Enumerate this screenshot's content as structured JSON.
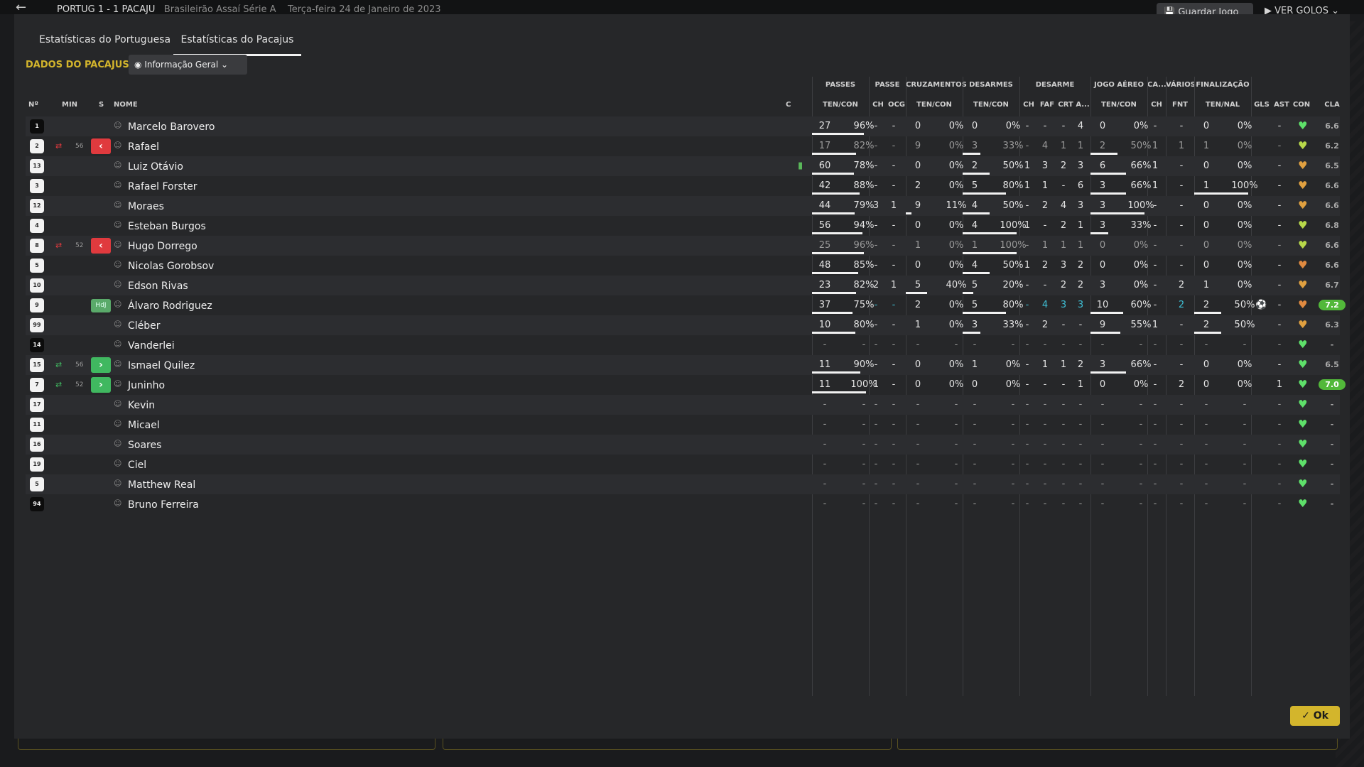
{
  "app": {
    "back_icon": "arrow-left-icon",
    "match_title": "PORTUG 1 - 1 PACAJU",
    "competition": "Brasileirão Assaí Série A",
    "date": "Terça-feira 24 de Janeiro de 2023",
    "save_label": "Guardar Jogo",
    "goals_label": "VER GOLOS"
  },
  "tabs": [
    {
      "label": "Estatísticas do Portuguesa"
    },
    {
      "label": "Estatísticas do Pacajus"
    }
  ],
  "section_label": "DADOS DO PACAJUS",
  "view_dropdown": {
    "value": "Informação Geral",
    "icon": "eye-icon"
  },
  "groups": {
    "passes": "PASSES",
    "passe": "PASSE",
    "cruz": "CRUZAMENTOS",
    "desarmes": "DESARMES",
    "desarme": "DESARME",
    "jogo": "JOGO AÉREO",
    "ca": "CA...",
    "varios": "VÁRIOS",
    "final": "FINALIZAÇÃO"
  },
  "columns": {
    "no": "Nº",
    "min": "MIN",
    "s": "S",
    "nome": "NOME",
    "c": "C",
    "passes": "TEN/CON",
    "passe_ch": "CH",
    "passe_ocg": "OCG",
    "cruz": "TEN/CON",
    "desarmes": "TEN/CON",
    "des_ch": "CH",
    "des_faf": "FAF",
    "des_crt": "CRT",
    "des_a": "A...",
    "jogo": "TEN/CON",
    "ca_ch": "CH",
    "fnt": "FNT",
    "final": "TEN/NAL",
    "gls": "GLS",
    "ast": "AST",
    "con": "CON",
    "cla": "CLA"
  },
  "colors": {
    "accent": "#d3b52c",
    "sub_off": "#e03a3e",
    "sub_on": "#40b860",
    "rating_highlight": "#52b83a",
    "player_of_match": "#3fc0d6"
  },
  "players": [
    {
      "num": "1",
      "dark": true,
      "name": "Marcelo Barovero",
      "min": "",
      "s": "",
      "sub": "",
      "pt": "27",
      "pp": "96%",
      "pr": 0.96,
      "pch": "-",
      "ocg": "-",
      "ct": "0",
      "cp": "0%",
      "cr": 0,
      "dt": "0",
      "dp": "0%",
      "dr": 0,
      "dch": "-",
      "faf": "-",
      "crt": "-",
      "a": "4",
      "jt": "0",
      "jp": "0%",
      "jr": 0,
      "cach": "-",
      "fnt": "-",
      "ft": "0",
      "fp": "0%",
      "fr": 0,
      "gls": "",
      "ast": "-",
      "con": "#5ee06a",
      "cla": "6.6",
      "hl": false,
      "muted": false,
      "blue": false,
      "hdj": false,
      "c_icon": ""
    },
    {
      "num": "2",
      "dark": false,
      "name": "Rafael",
      "min": "56",
      "s": "off",
      "sub": "red",
      "pt": "17",
      "pp": "82%",
      "pr": 0.82,
      "pch": "-",
      "ocg": "-",
      "ct": "9",
      "cp": "0%",
      "cr": 0,
      "dt": "3",
      "dp": "33%",
      "dr": 0.33,
      "dch": "-",
      "faf": "4",
      "crt": "1",
      "a": "1",
      "jt": "2",
      "jp": "50%",
      "jr": 0.5,
      "cach": "1",
      "fnt": "1",
      "ft": "1",
      "fp": "0%",
      "fr": 0,
      "gls": "",
      "ast": "-",
      "con": "#b8d84a",
      "cla": "6.2",
      "hl": false,
      "muted": true,
      "blue": false,
      "hdj": false,
      "c_icon": ""
    },
    {
      "num": "13",
      "dark": false,
      "name": "Luiz Otávio",
      "min": "",
      "s": "",
      "sub": "",
      "pt": "60",
      "pp": "78%",
      "pr": 0.78,
      "pch": "-",
      "ocg": "-",
      "ct": "0",
      "cp": "0%",
      "cr": 0,
      "dt": "2",
      "dp": "50%",
      "dr": 0.5,
      "dch": "1",
      "faf": "3",
      "crt": "2",
      "a": "3",
      "jt": "6",
      "jp": "66%",
      "jr": 0.66,
      "cach": "1",
      "fnt": "-",
      "ft": "0",
      "fp": "0%",
      "fr": 0,
      "gls": "",
      "ast": "-",
      "con": "#e0a040",
      "cla": "6.5",
      "hl": false,
      "muted": false,
      "blue": false,
      "hdj": false,
      "c_icon": "card"
    },
    {
      "num": "3",
      "dark": false,
      "name": "Rafael Forster",
      "min": "",
      "s": "",
      "sub": "",
      "pt": "42",
      "pp": "88%",
      "pr": 0.88,
      "pch": "-",
      "ocg": "-",
      "ct": "2",
      "cp": "0%",
      "cr": 0,
      "dt": "5",
      "dp": "80%",
      "dr": 0.8,
      "dch": "1",
      "faf": "1",
      "crt": "-",
      "a": "6",
      "jt": "3",
      "jp": "66%",
      "jr": 0.66,
      "cach": "1",
      "fnt": "-",
      "ft": "1",
      "fp": "100%",
      "fr": 1,
      "gls": "",
      "ast": "-",
      "con": "#e0a040",
      "cla": "6.6",
      "hl": false,
      "muted": false,
      "blue": false,
      "hdj": false,
      "c_icon": ""
    },
    {
      "num": "12",
      "dark": false,
      "name": "Moraes",
      "min": "",
      "s": "",
      "sub": "",
      "pt": "44",
      "pp": "79%",
      "pr": 0.79,
      "pch": "3",
      "ocg": "1",
      "ct": "9",
      "cp": "11%",
      "cr": 0.11,
      "dt": "4",
      "dp": "50%",
      "dr": 0.5,
      "dch": "-",
      "faf": "2",
      "crt": "4",
      "a": "3",
      "jt": "3",
      "jp": "100%",
      "jr": 1,
      "cach": "-",
      "fnt": "-",
      "ft": "0",
      "fp": "0%",
      "fr": 0,
      "gls": "",
      "ast": "-",
      "con": "#e0a040",
      "cla": "6.6",
      "hl": false,
      "muted": false,
      "blue": false,
      "hdj": false,
      "c_icon": ""
    },
    {
      "num": "4",
      "dark": false,
      "name": "Esteban Burgos",
      "min": "",
      "s": "",
      "sub": "",
      "pt": "56",
      "pp": "94%",
      "pr": 0.94,
      "pch": "-",
      "ocg": "-",
      "ct": "0",
      "cp": "0%",
      "cr": 0,
      "dt": "4",
      "dp": "100%",
      "dr": 1,
      "dch": "1",
      "faf": "-",
      "crt": "2",
      "a": "1",
      "jt": "3",
      "jp": "33%",
      "jr": 0.33,
      "cach": "-",
      "fnt": "-",
      "ft": "0",
      "fp": "0%",
      "fr": 0,
      "gls": "",
      "ast": "-",
      "con": "#b8d84a",
      "cla": "6.8",
      "hl": false,
      "muted": false,
      "blue": false,
      "hdj": false,
      "c_icon": ""
    },
    {
      "num": "8",
      "dark": false,
      "name": "Hugo Dorrego",
      "min": "52",
      "s": "off",
      "sub": "red",
      "pt": "25",
      "pp": "96%",
      "pr": 0.96,
      "pch": "-",
      "ocg": "-",
      "ct": "1",
      "cp": "0%",
      "cr": 0,
      "dt": "1",
      "dp": "100%",
      "dr": 1,
      "dch": "-",
      "faf": "1",
      "crt": "1",
      "a": "1",
      "jt": "0",
      "jp": "0%",
      "jr": 0,
      "cach": "-",
      "fnt": "-",
      "ft": "0",
      "fp": "0%",
      "fr": 0,
      "gls": "",
      "ast": "-",
      "con": "#b8d84a",
      "cla": "6.6",
      "hl": false,
      "muted": true,
      "blue": false,
      "hdj": false,
      "c_icon": ""
    },
    {
      "num": "5",
      "dark": false,
      "name": "Nicolas Gorobsov",
      "min": "",
      "s": "",
      "sub": "",
      "pt": "48",
      "pp": "85%",
      "pr": 0.85,
      "pch": "-",
      "ocg": "-",
      "ct": "0",
      "cp": "0%",
      "cr": 0,
      "dt": "4",
      "dp": "50%",
      "dr": 0.5,
      "dch": "1",
      "faf": "2",
      "crt": "3",
      "a": "2",
      "jt": "0",
      "jp": "0%",
      "jr": 0,
      "cach": "-",
      "fnt": "-",
      "ft": "0",
      "fp": "0%",
      "fr": 0,
      "gls": "",
      "ast": "-",
      "con": "#e08a40",
      "cla": "6.6",
      "hl": false,
      "muted": false,
      "blue": false,
      "hdj": false,
      "c_icon": ""
    },
    {
      "num": "10",
      "dark": false,
      "name": "Edson Rivas",
      "min": "",
      "s": "",
      "sub": "",
      "pt": "23",
      "pp": "82%",
      "pr": 0.82,
      "pch": "2",
      "ocg": "1",
      "ct": "5",
      "cp": "40%",
      "cr": 0.4,
      "dt": "5",
      "dp": "20%",
      "dr": 0.2,
      "dch": "-",
      "faf": "-",
      "crt": "2",
      "a": "2",
      "jt": "3",
      "jp": "0%",
      "jr": 0,
      "cach": "-",
      "fnt": "2",
      "ft": "1",
      "fp": "0%",
      "fr": 0,
      "gls": "",
      "ast": "-",
      "con": "#e0a040",
      "cla": "6.7",
      "hl": false,
      "muted": false,
      "blue": false,
      "hdj": false,
      "c_icon": ""
    },
    {
      "num": "9",
      "dark": false,
      "name": "Álvaro Rodriguez",
      "min": "",
      "s": "",
      "sub": "",
      "pt": "37",
      "pp": "75%",
      "pr": 0.75,
      "pch": "-",
      "ocg": "-",
      "ct": "2",
      "cp": "0%",
      "cr": 0,
      "dt": "5",
      "dp": "80%",
      "dr": 0.8,
      "dch": "-",
      "faf": "4",
      "crt": "3",
      "a": "3",
      "jt": "10",
      "jp": "60%",
      "jr": 0.6,
      "cach": "-",
      "fnt": "2",
      "ft": "2",
      "fp": "50%",
      "fr": 0.5,
      "gls": "ball",
      "ast": "-",
      "con": "#e08a40",
      "cla": "7.2",
      "hl": true,
      "muted": false,
      "blue": true,
      "hdj": true,
      "c_icon": ""
    },
    {
      "num": "99",
      "dark": false,
      "name": "Cléber",
      "min": "",
      "s": "",
      "sub": "",
      "pt": "10",
      "pp": "80%",
      "pr": 0.8,
      "pch": "-",
      "ocg": "-",
      "ct": "1",
      "cp": "0%",
      "cr": 0,
      "dt": "3",
      "dp": "33%",
      "dr": 0.33,
      "dch": "-",
      "faf": "2",
      "crt": "-",
      "a": "-",
      "jt": "9",
      "jp": "55%",
      "jr": 0.55,
      "cach": "1",
      "fnt": "-",
      "ft": "2",
      "fp": "50%",
      "fr": 0.5,
      "gls": "",
      "ast": "-",
      "con": "#e0a040",
      "cla": "6.3",
      "hl": false,
      "muted": false,
      "blue": false,
      "hdj": false,
      "c_icon": ""
    },
    {
      "num": "14",
      "dark": true,
      "name": "Vanderlei",
      "min": "",
      "s": "",
      "sub": "",
      "pt": "-",
      "pp": "-",
      "pr": 0,
      "pch": "-",
      "ocg": "-",
      "ct": "-",
      "cp": "-",
      "cr": 0,
      "dt": "-",
      "dp": "-",
      "dr": 0,
      "dch": "-",
      "faf": "-",
      "crt": "-",
      "a": "-",
      "jt": "-",
      "jp": "-",
      "jr": 0,
      "cach": "-",
      "fnt": "-",
      "ft": "-",
      "fp": "-",
      "fr": 0,
      "gls": "",
      "ast": "-",
      "con": "#5ee06a",
      "cla": "-",
      "hl": false,
      "muted": true,
      "blue": false,
      "hdj": false,
      "c_icon": ""
    },
    {
      "num": "15",
      "dark": false,
      "name": "Ismael Quilez",
      "min": "56",
      "s": "on",
      "sub": "green",
      "pt": "11",
      "pp": "90%",
      "pr": 0.9,
      "pch": "-",
      "ocg": "-",
      "ct": "0",
      "cp": "0%",
      "cr": 0,
      "dt": "1",
      "dp": "0%",
      "dr": 0,
      "dch": "-",
      "faf": "1",
      "crt": "1",
      "a": "2",
      "jt": "3",
      "jp": "66%",
      "jr": 0.66,
      "cach": "-",
      "fnt": "-",
      "ft": "0",
      "fp": "0%",
      "fr": 0,
      "gls": "",
      "ast": "-",
      "con": "#5ee06a",
      "cla": "6.5",
      "hl": false,
      "muted": false,
      "blue": false,
      "hdj": false,
      "c_icon": ""
    },
    {
      "num": "7",
      "dark": false,
      "name": "Juninho",
      "min": "52",
      "s": "on",
      "sub": "green",
      "pt": "11",
      "pp": "100%",
      "pr": 1,
      "pch": "1",
      "ocg": "-",
      "ct": "0",
      "cp": "0%",
      "cr": 0,
      "dt": "0",
      "dp": "0%",
      "dr": 0,
      "dch": "-",
      "faf": "-",
      "crt": "-",
      "a": "1",
      "jt": "0",
      "jp": "0%",
      "jr": 0,
      "cach": "-",
      "fnt": "2",
      "ft": "0",
      "fp": "0%",
      "fr": 0,
      "gls": "",
      "ast": "1",
      "con": "#5ee06a",
      "cla": "7.0",
      "hl": true,
      "muted": false,
      "blue": false,
      "hdj": false,
      "c_icon": ""
    },
    {
      "num": "17",
      "dark": false,
      "name": "Kevin",
      "min": "",
      "s": "",
      "sub": "",
      "pt": "-",
      "pp": "-",
      "pr": 0,
      "pch": "-",
      "ocg": "-",
      "ct": "-",
      "cp": "-",
      "cr": 0,
      "dt": "-",
      "dp": "-",
      "dr": 0,
      "dch": "-",
      "faf": "-",
      "crt": "-",
      "a": "-",
      "jt": "-",
      "jp": "-",
      "jr": 0,
      "cach": "-",
      "fnt": "-",
      "ft": "-",
      "fp": "-",
      "fr": 0,
      "gls": "",
      "ast": "-",
      "con": "#5ee06a",
      "cla": "-",
      "hl": false,
      "muted": true,
      "blue": false,
      "hdj": false,
      "c_icon": ""
    },
    {
      "num": "11",
      "dark": false,
      "name": "Micael",
      "min": "",
      "s": "",
      "sub": "",
      "pt": "-",
      "pp": "-",
      "pr": 0,
      "pch": "-",
      "ocg": "-",
      "ct": "-",
      "cp": "-",
      "cr": 0,
      "dt": "-",
      "dp": "-",
      "dr": 0,
      "dch": "-",
      "faf": "-",
      "crt": "-",
      "a": "-",
      "jt": "-",
      "jp": "-",
      "jr": 0,
      "cach": "-",
      "fnt": "-",
      "ft": "-",
      "fp": "-",
      "fr": 0,
      "gls": "",
      "ast": "-",
      "con": "#5ee06a",
      "cla": "-",
      "hl": false,
      "muted": true,
      "blue": false,
      "hdj": false,
      "c_icon": ""
    },
    {
      "num": "16",
      "dark": false,
      "name": "Soares",
      "min": "",
      "s": "",
      "sub": "",
      "pt": "-",
      "pp": "-",
      "pr": 0,
      "pch": "-",
      "ocg": "-",
      "ct": "-",
      "cp": "-",
      "cr": 0,
      "dt": "-",
      "dp": "-",
      "dr": 0,
      "dch": "-",
      "faf": "-",
      "crt": "-",
      "a": "-",
      "jt": "-",
      "jp": "-",
      "jr": 0,
      "cach": "-",
      "fnt": "-",
      "ft": "-",
      "fp": "-",
      "fr": 0,
      "gls": "",
      "ast": "-",
      "con": "#5ee06a",
      "cla": "-",
      "hl": false,
      "muted": true,
      "blue": false,
      "hdj": false,
      "c_icon": ""
    },
    {
      "num": "19",
      "dark": false,
      "name": "Ciel",
      "min": "",
      "s": "",
      "sub": "",
      "pt": "-",
      "pp": "-",
      "pr": 0,
      "pch": "-",
      "ocg": "-",
      "ct": "-",
      "cp": "-",
      "cr": 0,
      "dt": "-",
      "dp": "-",
      "dr": 0,
      "dch": "-",
      "faf": "-",
      "crt": "-",
      "a": "-",
      "jt": "-",
      "jp": "-",
      "jr": 0,
      "cach": "-",
      "fnt": "-",
      "ft": "-",
      "fp": "-",
      "fr": 0,
      "gls": "",
      "ast": "-",
      "con": "#5ee06a",
      "cla": "-",
      "hl": false,
      "muted": true,
      "blue": false,
      "hdj": false,
      "c_icon": ""
    },
    {
      "num": "5",
      "dark": false,
      "name": "Matthew Real",
      "min": "",
      "s": "",
      "sub": "",
      "pt": "-",
      "pp": "-",
      "pr": 0,
      "pch": "-",
      "ocg": "-",
      "ct": "-",
      "cp": "-",
      "cr": 0,
      "dt": "-",
      "dp": "-",
      "dr": 0,
      "dch": "-",
      "faf": "-",
      "crt": "-",
      "a": "-",
      "jt": "-",
      "jp": "-",
      "jr": 0,
      "cach": "-",
      "fnt": "-",
      "ft": "-",
      "fp": "-",
      "fr": 0,
      "gls": "",
      "ast": "-",
      "con": "#5ee06a",
      "cla": "-",
      "hl": false,
      "muted": true,
      "blue": false,
      "hdj": false,
      "c_icon": ""
    },
    {
      "num": "94",
      "dark": true,
      "name": "Bruno Ferreira",
      "min": "",
      "s": "",
      "sub": "",
      "pt": "-",
      "pp": "-",
      "pr": 0,
      "pch": "-",
      "ocg": "-",
      "ct": "-",
      "cp": "-",
      "cr": 0,
      "dt": "-",
      "dp": "-",
      "dr": 0,
      "dch": "-",
      "faf": "-",
      "crt": "-",
      "a": "-",
      "jt": "-",
      "jp": "-",
      "jr": 0,
      "cach": "-",
      "fnt": "-",
      "ft": "-",
      "fp": "-",
      "fr": 0,
      "gls": "",
      "ast": "-",
      "con": "#5ee06a",
      "cla": "-",
      "hl": false,
      "muted": true,
      "blue": false,
      "hdj": false,
      "c_icon": ""
    }
  ],
  "ok_label": "Ok"
}
